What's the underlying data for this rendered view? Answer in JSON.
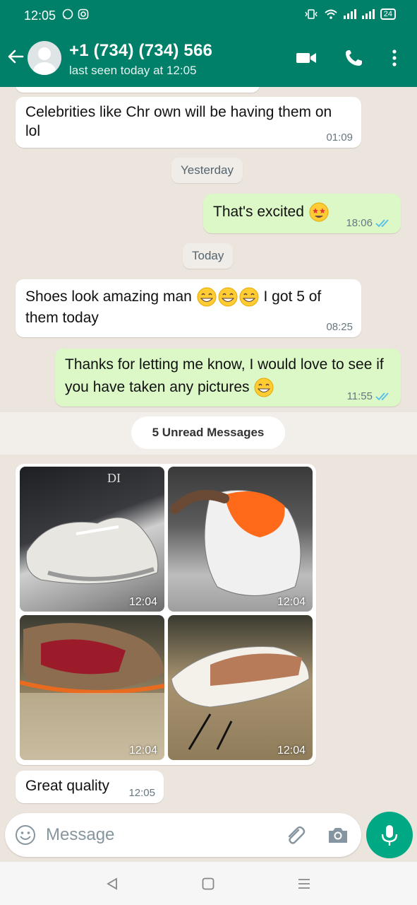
{
  "status_bar": {
    "time": "12:05",
    "battery": "24"
  },
  "header": {
    "contact_name": "+1 (734) (734) 566",
    "last_seen": "last seen today at 12:05"
  },
  "messages": [
    {
      "text": "Celebrities like Chr   own will be having them on lol",
      "time": "01:09"
    },
    {
      "text": "That's excited",
      "time": "18:06"
    },
    {
      "text_before": "Shoes look amazing man",
      "text_after": "I got 5 of them today",
      "time": "08:25"
    },
    {
      "text": "Thanks for letting me know, I would love to see if you have taken any pictures",
      "time": "11:55"
    },
    {
      "text": "Great quality",
      "time": "12:05"
    }
  ],
  "date_pills": {
    "yesterday": "Yesterday",
    "today": "Today"
  },
  "unread_label": "5 Unread Messages",
  "photos": [
    {
      "time": "12:04",
      "subject": "DI"
    },
    {
      "time": "12:04"
    },
    {
      "time": "12:04"
    },
    {
      "time": "12:04"
    }
  ],
  "input": {
    "placeholder": "Message"
  },
  "colors": {
    "header": "#008069",
    "outgoing": "#dcf8c6",
    "accent": "#00a884",
    "read_ticks": "#53bdeb"
  }
}
